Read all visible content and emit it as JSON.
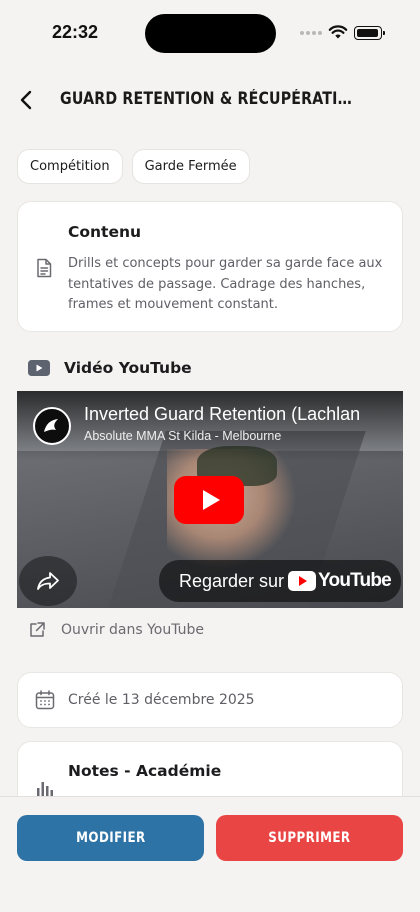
{
  "status_bar": {
    "time": "22:32"
  },
  "header": {
    "title": "GUARD RETENTION & RÉCUPÉRATION DE..."
  },
  "tags": [
    "Compétition",
    "Garde Fermée"
  ],
  "content": {
    "title": "Contenu",
    "description": "Drills et concepts pour garder sa garde face aux tentatives de passage. Cadrage des hanches, frames et mouvement constant."
  },
  "video_section": {
    "title": "Vidéo YouTube",
    "video_title": "Inverted Guard Retention (Lachlan",
    "channel": "Absolute MMA St Kilda - Melbourne",
    "watch_on": "Regarder sur",
    "yt_word": "YouTube",
    "open_link": "Ouvrir dans YouTube"
  },
  "date": {
    "text": "Créé le 13 décembre 2025"
  },
  "notes": {
    "title": "Notes - Académie"
  },
  "actions": {
    "edit": "MODIFIER",
    "delete": "SUPPRIMER"
  },
  "colors": {
    "edit": "#2e73a5",
    "delete": "#ea4545",
    "youtube_red": "#ff0000"
  }
}
